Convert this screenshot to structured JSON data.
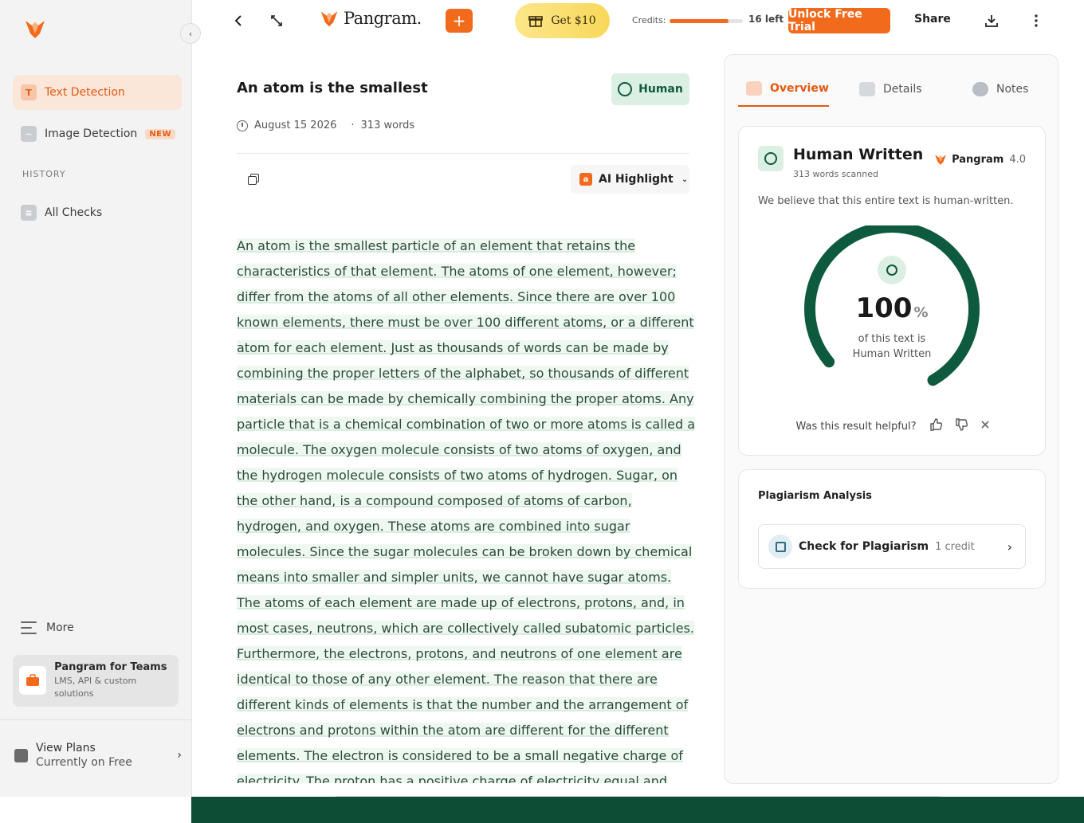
{
  "sidebar": {
    "nav": [
      {
        "label": "Text Detection",
        "icon": "text-detection-icon",
        "active": true
      },
      {
        "label": "Image Detection",
        "icon": "image-detection-icon",
        "badge": "NEW"
      },
      {
        "label": "All Checks",
        "icon": "all-checks-icon"
      }
    ],
    "history_label": "HISTORY",
    "more_label": "More",
    "teams": {
      "title": "Pangram for Teams",
      "subtitle": "LMS, API & custom solutions"
    },
    "plans": {
      "title": "View Plans",
      "subtitle": "Currently on Free"
    }
  },
  "topbar": {
    "brand": "Pangram.",
    "plus": "+",
    "get_label": "Get $10",
    "credits_label": "Credits:",
    "credits_left": "16 left",
    "credits_fraction": 0.8,
    "unlock_label": "Unlock Free Trial",
    "share_label": "Share"
  },
  "document": {
    "title": "An atom is the smallest",
    "verdict_label": "Human",
    "date": "August 15 2026",
    "separator": "·",
    "word_count": "313 words",
    "highlight_label": "AI Highlight",
    "ai_icon_letter": "a",
    "body": "An atom is the smallest particle of an element that retains the characteristics of that element. The atoms of one element, however; differ from the atoms of all other elements. Since there are over 100 known elements, there must be over 100 different atoms, or a different atom for each element. Just as thousands of words can be made by combining the proper letters of the alphabet, so thousands of different materials can be made by chemically combining the proper atoms. Any particle that is a chemical combination of two or more atoms is called a molecule. The oxygen molecule consists of two atoms of oxygen, and the hydrogen molecule consists of two atoms of hydrogen. Sugar, on the other hand, is a compound composed of atoms of carbon, hydrogen, and oxygen. These atoms are combined into sugar molecules. Since the sugar molecules can be broken down by chemical means into smaller and simpler units, we cannot have sugar atoms. The atoms of each element are made up of electrons, protons, and, in most cases, neutrons, which are collectively called subatomic particles. Furthermore, the electrons, protons, and neutrons of one element are identical to those of any other element. The reason that there are different kinds of elements is that the number and the arrangement of electrons and protons within the atom are different for the different elements. The electron is considered to be a small negative charge of electricity. The proton has a positive charge of electricity equal and opposite to the charge of the electron. Scientists have measured the mass and size of the electron and proton, and they know how"
  },
  "panel": {
    "tabs": [
      {
        "label": "Overview",
        "icon": "overview-icon",
        "active": true
      },
      {
        "label": "Details",
        "icon": "details-icon"
      },
      {
        "label": "Notes",
        "icon": "notes-icon"
      }
    ],
    "result": {
      "title": "Human Written",
      "scanned": "313 words scanned",
      "model_name": "Pangram",
      "model_version": "4.0",
      "belief": "We believe that this entire text is human-written.",
      "percent": "100",
      "percent_sign": "%",
      "percent_fraction": 1.0,
      "caption_line1": "of this text is",
      "caption_line2": "Human Written",
      "helpful_question": "Was this result helpful?"
    },
    "plagiarism": {
      "title": "Plagiarism Analysis",
      "action_label": "Check for Plagiarism",
      "cost": "1 credit"
    }
  },
  "colors": {
    "accent": "#f26a1b",
    "human_green": "#0e5a3e",
    "footer": "#0e4d35"
  }
}
